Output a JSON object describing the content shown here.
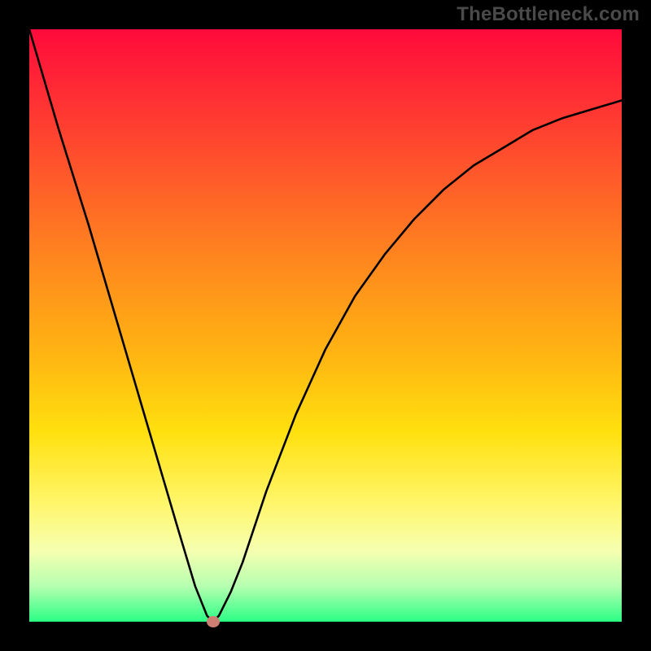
{
  "watermark": "TheBottleneck.com",
  "chart_data": {
    "type": "line",
    "title": "",
    "xlabel": "",
    "ylabel": "",
    "xlim": [
      0,
      100
    ],
    "ylim": [
      0,
      100
    ],
    "series": [
      {
        "name": "curve",
        "x": [
          0,
          5,
          10,
          15,
          20,
          25,
          28,
          30,
          31,
          32,
          34,
          36,
          40,
          45,
          50,
          55,
          60,
          65,
          70,
          75,
          80,
          85,
          90,
          95,
          100
        ],
        "y": [
          100,
          83,
          67,
          50,
          33,
          16,
          6,
          1,
          0,
          1,
          5,
          10,
          22,
          35,
          46,
          55,
          62,
          68,
          73,
          77,
          80,
          83,
          85,
          86.5,
          88
        ]
      }
    ],
    "marker": {
      "x": 31,
      "y": 0
    },
    "gradient_stops": [
      {
        "pos": 0.0,
        "color": "#ff0a3a"
      },
      {
        "pos": 0.25,
        "color": "#ff5a2a"
      },
      {
        "pos": 0.55,
        "color": "#ffb512"
      },
      {
        "pos": 0.8,
        "color": "#fff66a"
      },
      {
        "pos": 0.94,
        "color": "#b6ffb0"
      },
      {
        "pos": 1.0,
        "color": "#2aff84"
      }
    ]
  }
}
